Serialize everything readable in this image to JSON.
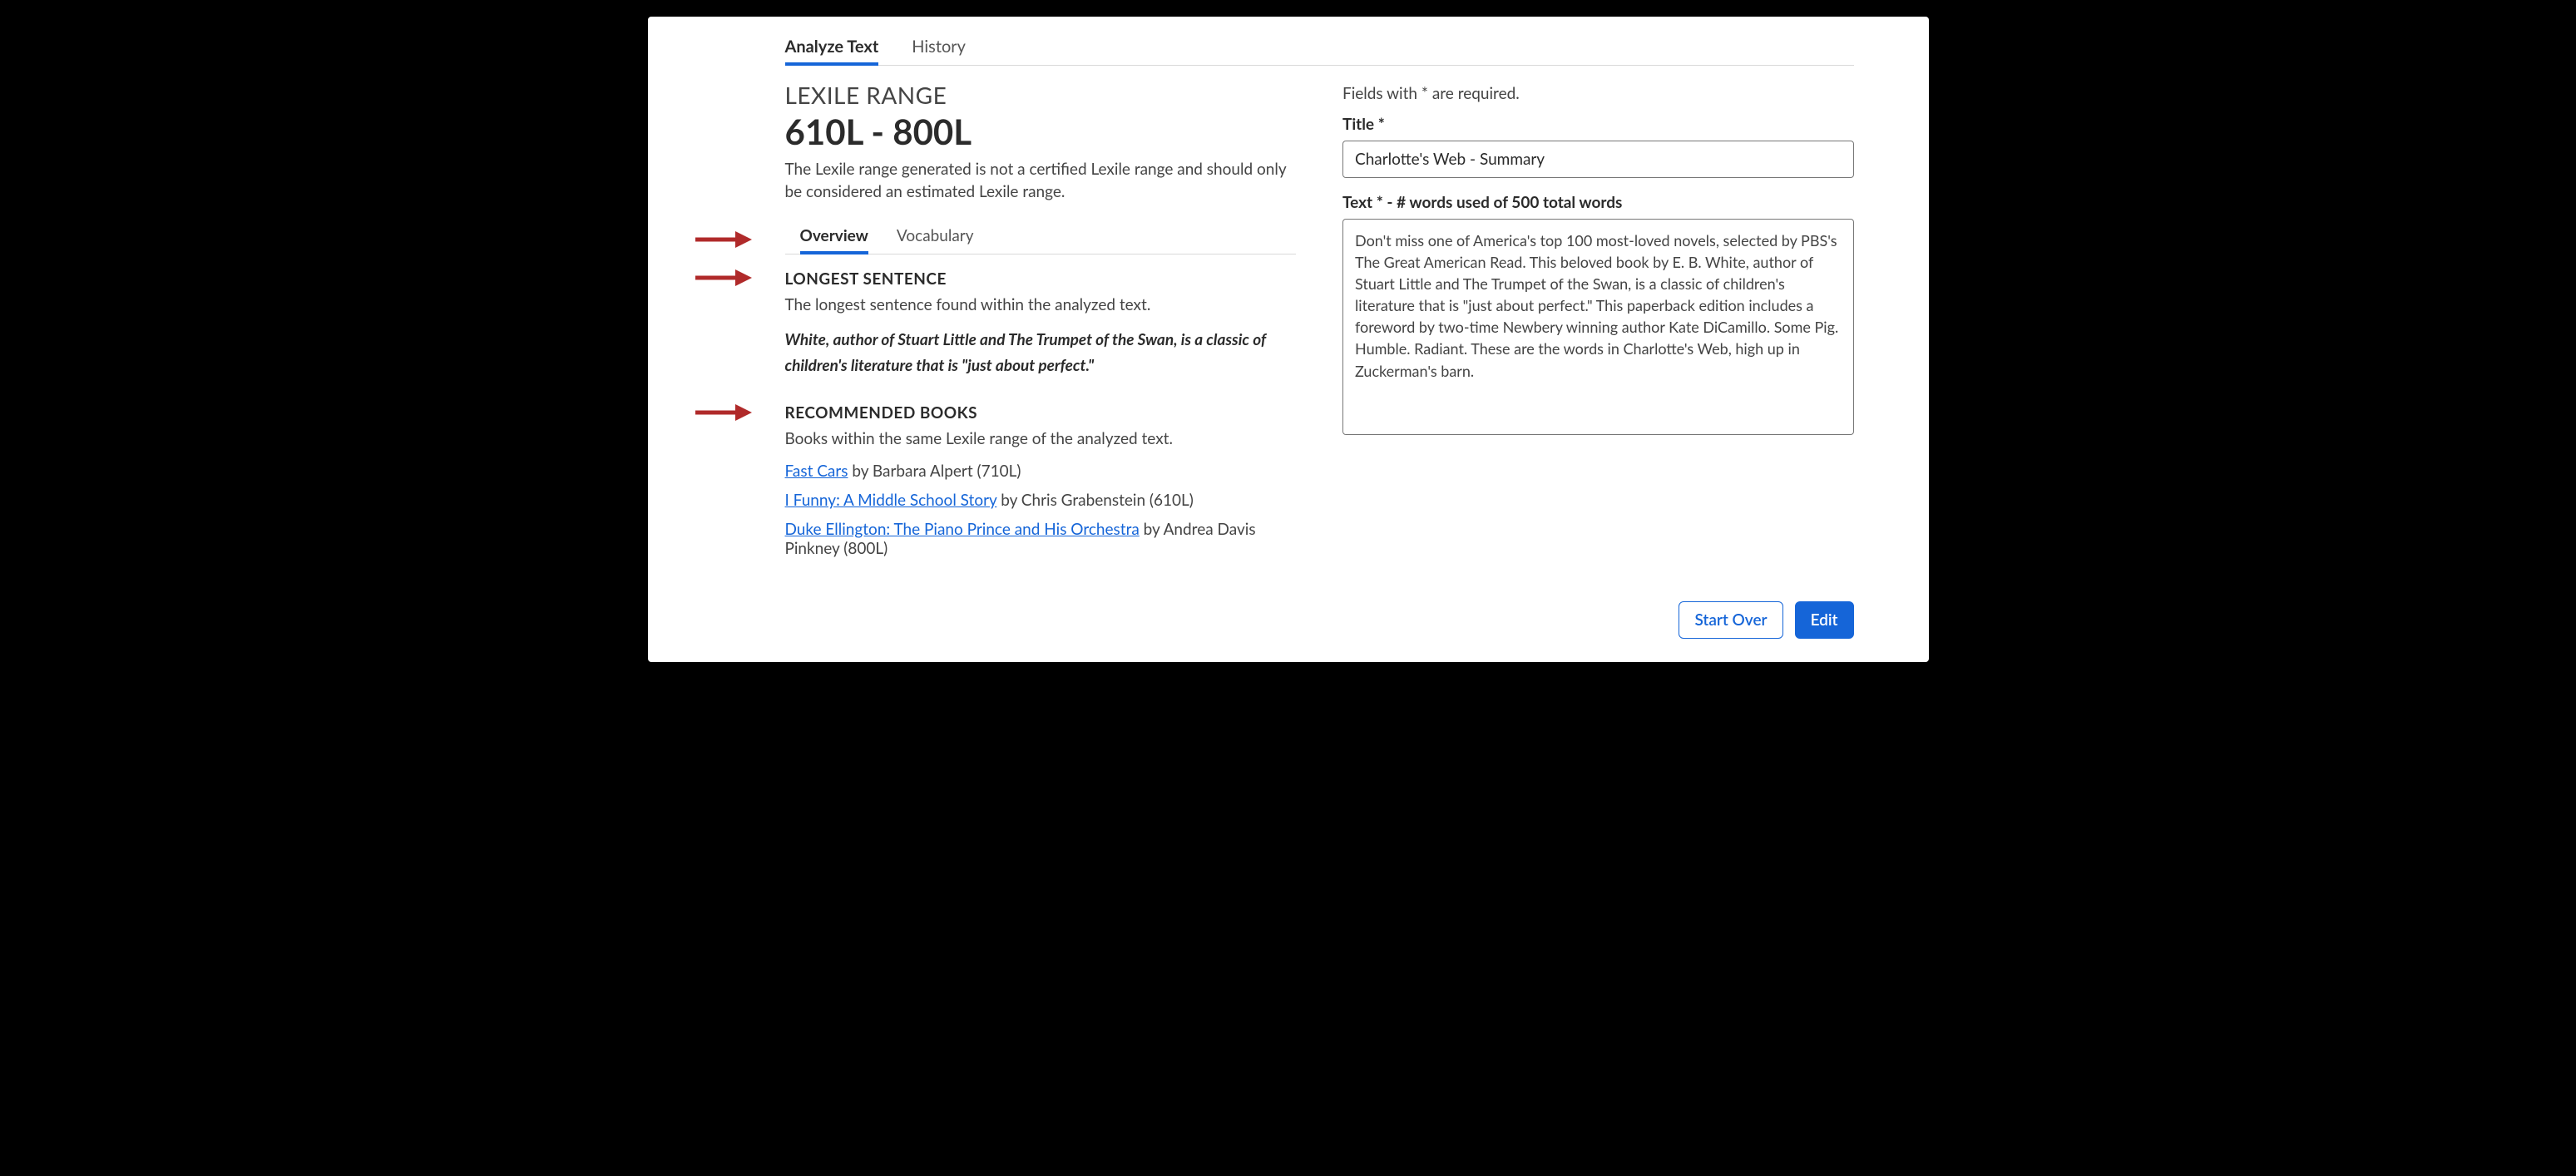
{
  "topTabs": {
    "analyze": "Analyze Text",
    "history": "History"
  },
  "lexile": {
    "heading": "LEXILE RANGE",
    "value": "610L - 800L",
    "note": "The Lexile range generated is not a certified Lexile range and should only be considered an estimated Lexile range."
  },
  "subTabs": {
    "overview": "Overview",
    "vocab": "Vocabulary"
  },
  "longest": {
    "heading": "LONGEST SENTENCE",
    "sub": "The longest sentence found within the analyzed  text.",
    "quote": "White, author of Stuart Little and The Trumpet of the Swan, is a classic of children's literature that is \"just about perfect.\""
  },
  "recommended": {
    "heading": "RECOMMENDED BOOKS",
    "sub": "Books within the same Lexile range of the analyzed text.",
    "items": [
      {
        "title": "Fast Cars",
        "meta": " by Barbara Alpert (710L)"
      },
      {
        "title": "I Funny: A Middle School Story",
        "meta": " by Chris Grabenstein (610L)"
      },
      {
        "title": "Duke Ellington: The Piano Prince and His Orchestra",
        "meta": " by Andrea Davis Pinkney (800L)"
      }
    ]
  },
  "form": {
    "requiredHint": "Fields with * are required.",
    "titleLabel": "Title *",
    "titleValue": "Charlotte's Web - Summary",
    "textLabelBold": "Text *",
    "textLabelRest": " -  # words used of 500 total words",
    "textValue": "Don't miss one of America's top 100 most-loved novels, selected by PBS's The Great American Read. This beloved book by E. B. White, author of Stuart Little and The Trumpet of the Swan, is a classic of children's literature that is \"just about perfect.\" This paperback edition includes a foreword by two-time Newbery winning author Kate DiCamillo. Some Pig. Humble. Radiant. These are the words in Charlotte's Web, high up in Zuckerman's barn."
  },
  "actions": {
    "startOver": "Start Over",
    "edit": "Edit"
  }
}
